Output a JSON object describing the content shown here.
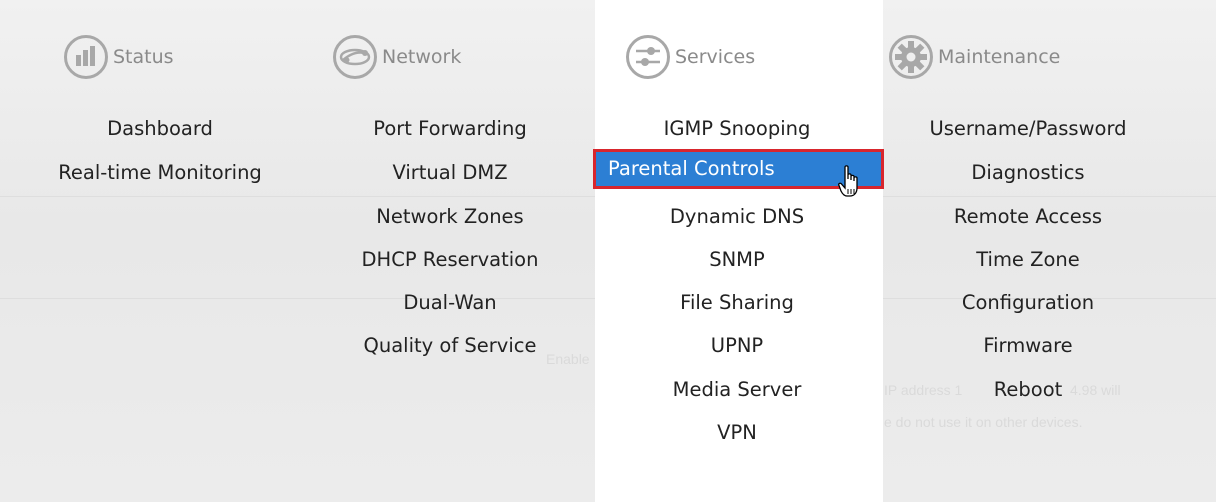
{
  "background_text": {
    "enable": "Enable",
    "notice_line1_left": "IP address 1",
    "notice_line1_right": "4.98 will",
    "notice_line2": "e do not use it on other devices."
  },
  "columns": [
    {
      "title": "Status",
      "icon": "bar-chart-icon",
      "items": [
        "Dashboard",
        "Real-time Monitoring"
      ]
    },
    {
      "title": "Network",
      "icon": "network-globe-icon",
      "items": [
        "Port Forwarding",
        "Virtual DMZ",
        "Network Zones",
        "DHCP Reservation",
        "Dual-Wan",
        "Quality of Service"
      ]
    },
    {
      "title": "Services",
      "icon": "sliders-icon",
      "items": [
        "IGMP Snooping",
        "Parental Controls",
        "Dynamic DNS",
        "SNMP",
        "File Sharing",
        "UPNP",
        "Media Server",
        "VPN"
      ]
    },
    {
      "title": "Maintenance",
      "icon": "gear-icon",
      "items": [
        "Username/Password",
        "Diagnostics",
        "Remote Access",
        "Time Zone",
        "Configuration",
        "Firmware",
        "Reboot"
      ]
    }
  ],
  "selected_item": "Parental Controls",
  "colors": {
    "highlight_bg": "#2c7fd4",
    "highlight_border": "#d8262d",
    "icon_gray": "#a8a8a8"
  }
}
